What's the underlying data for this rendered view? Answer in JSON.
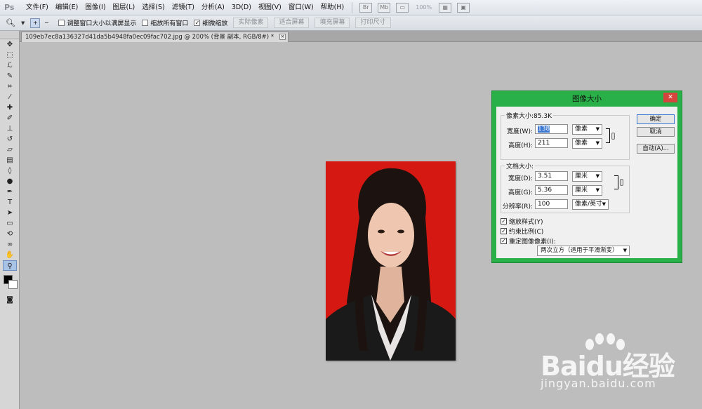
{
  "menubar": {
    "logo": "Ps",
    "items": [
      "文件(F)",
      "编辑(E)",
      "图像(I)",
      "图层(L)",
      "选择(S)",
      "滤镜(T)",
      "分析(A)",
      "3D(D)",
      "视图(V)",
      "窗口(W)",
      "帮助(H)"
    ],
    "zoom": "100%"
  },
  "options": {
    "tool_icon": "zoom-tool",
    "fit_window_label": "调整窗口大小以满屏显示",
    "zoom_all_label": "缩放所有窗口",
    "scrubby_label": "细微缩放",
    "actual_pixels": "实际像素",
    "fit_screen": "适合屏幕",
    "fill_screen": "填充屏幕",
    "print_size": "打印尺寸"
  },
  "document": {
    "tab_title": "109eb7ec8a136327d41da5b4948fa0ec09fac702.jpg @ 200% (背景 副本, RGB/8#) *"
  },
  "dialog": {
    "title": "图像大小",
    "pixel_dims_label": "像素大小:85.3K",
    "width_label": "宽度(W):",
    "width_value": "138",
    "height_label": "高度(H):",
    "height_value": "211",
    "pixel_unit": "像素",
    "doc_size_label": "文档大小:",
    "doc_width_label": "宽度(D):",
    "doc_width_value": "3.51",
    "doc_height_label": "高度(G):",
    "doc_height_value": "5.36",
    "doc_unit": "厘米",
    "resolution_label": "分辨率(R):",
    "resolution_value": "100",
    "resolution_unit": "像素/英寸",
    "scale_styles": "缩放样式(Y)",
    "constrain": "约束比例(C)",
    "resample": "重定图像像素(I):",
    "resample_method": "两次立方（适用于平滑渐变）",
    "ok": "确定",
    "cancel": "取消",
    "auto": "自动(A)..."
  },
  "watermark": {
    "brand": "Baidu经验",
    "url": "jingyan.baidu.com"
  },
  "colors": {
    "dialog_border": "#2ab048",
    "photo_bg": "#d61812",
    "selection": "#3a77d0"
  }
}
